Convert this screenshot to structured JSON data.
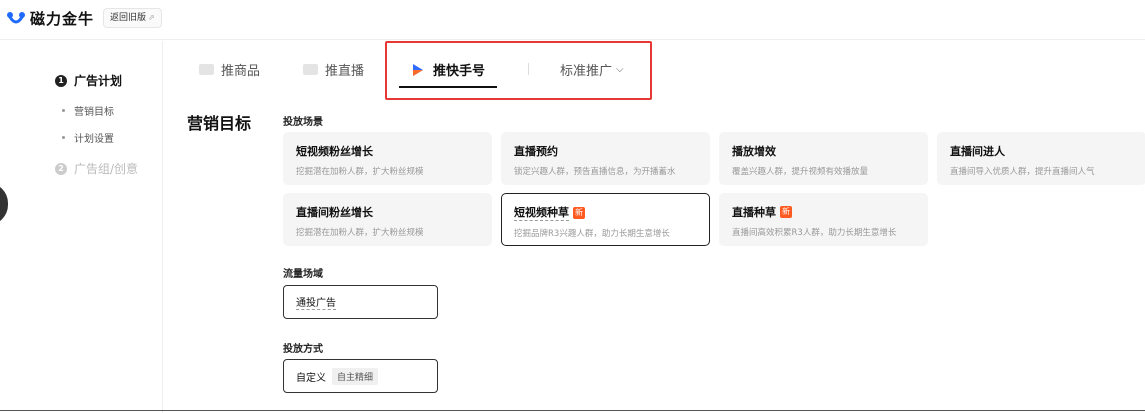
{
  "app": {
    "name": "磁力金牛",
    "old_version_label": "返回旧版"
  },
  "sidebar": {
    "steps": [
      {
        "num": "1",
        "label": "广告计划"
      },
      {
        "num": "2",
        "label": "广告组/创意"
      }
    ],
    "sub_items": [
      "营销目标",
      "计划设置"
    ]
  },
  "tabs": [
    {
      "label": "推商品"
    },
    {
      "label": "推直播"
    },
    {
      "label": "推快手号"
    },
    {
      "label": "标准推广"
    }
  ],
  "section_title": "营销目标",
  "placement": {
    "label": "投放场景",
    "cards": [
      {
        "title": "短视频粉丝增长",
        "desc": "挖掘潜在加粉人群，扩大粉丝规模"
      },
      {
        "title": "直播预约",
        "desc": "锁定兴趣人群，预告直播信息，为开播蓄水"
      },
      {
        "title": "播放增效",
        "desc": "覆盖兴趣人群，提升视频有效播放量"
      },
      {
        "title": "直播间进人",
        "desc": "直播间导入优质人群，提升直播间人气"
      },
      {
        "title": "直播间粉丝增长",
        "desc": "挖掘潜在加粉人群，扩大粉丝规模"
      },
      {
        "title": "短视频种草",
        "desc": "挖掘品牌R3兴趣人群，助力长期生意增长",
        "badge": "新"
      },
      {
        "title": "直播种草",
        "desc": "直播间高效积累R3人群，助力长期生意增长",
        "badge": "新"
      }
    ]
  },
  "traffic": {
    "label": "流量场域",
    "value": "通投广告"
  },
  "delivery": {
    "label": "投放方式",
    "value": "自定义",
    "tag": "自主精细"
  },
  "colors": {
    "highlight_border": "#e53935",
    "new_badge": "#ff5a1f"
  }
}
